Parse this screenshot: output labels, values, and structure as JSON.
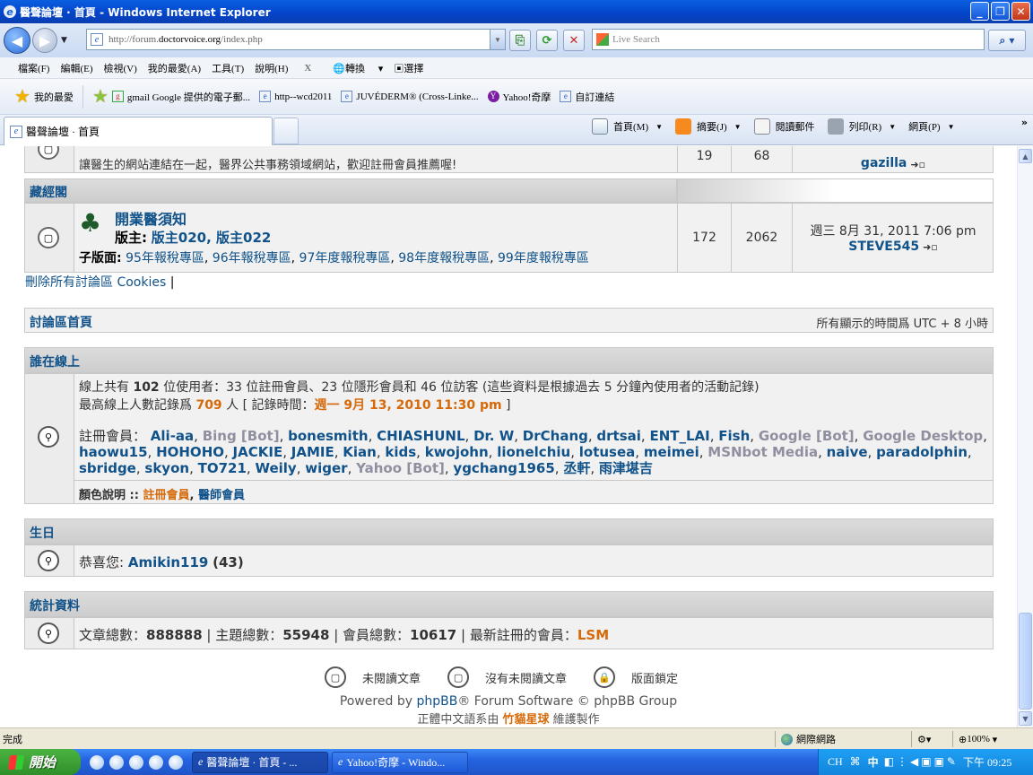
{
  "window": {
    "title": "醫聲論壇 · 首頁 - Windows Internet Explorer",
    "minimize": "_",
    "restore": "❐",
    "close": "✕"
  },
  "address": {
    "url_prefix": "http://forum.",
    "url_domain": "doctorvoice.org",
    "url_suffix": "/index.php",
    "search_placeholder": "Live Search"
  },
  "menu": [
    "檔案(F)",
    "編輯(E)",
    "檢視(V)",
    "我的最愛(A)",
    "工具(T)",
    "說明(H)"
  ],
  "menu_extra": {
    "close_x": "X",
    "translate": "轉換",
    "select": "選擇"
  },
  "favorites": {
    "label": "我的最愛",
    "items": [
      "gmail Google 提供的電子郵...",
      "http--wcd2011",
      "JUVÉDERM® (Cross-Linke...",
      "Yahoo!奇摩",
      "自訂連結"
    ]
  },
  "tabs": {
    "active_label": "醫聲論壇 · 首頁"
  },
  "commands": {
    "home": "首頁(M)",
    "feeds": "摘要(J)",
    "mail": "閱讀郵件",
    "print": "列印(R)",
    "page": "網頁(P)",
    "more": "»"
  },
  "forum": {
    "partial_row": {
      "desc": "讓醫生的網站連結在一起，醫界公共事務領域網站，歡迎註冊會員推薦喔!",
      "topics": "19",
      "posts": "68",
      "last_user": "gazilla"
    },
    "category2": "藏經閣",
    "forum2": {
      "title": "開業醫須知",
      "mods_label": "版主:",
      "mods": "版主020, 版主022",
      "sub_label": "子版面:",
      "subforums": [
        "95年報稅專區",
        "96年報稅專區",
        "97年度報稅專區",
        "98年度報稅專區",
        "99年度報稅專區"
      ],
      "topics": "172",
      "posts": "2062",
      "last_time": "週三 8月 31, 2011 7:06 pm",
      "last_user": "STEVE545"
    },
    "links": {
      "delete_all": "刪除所有討論區 Cookies",
      "sep": "|"
    },
    "nav": {
      "index": "討論區首頁",
      "timezone": "所有顯示的時間爲 UTC + 8 小時"
    },
    "online": {
      "heading": "誰在線上",
      "line1_a": "線上共有",
      "line1_count": "102",
      "line1_b": "位使用者：33 位註冊會員、23 位隱形會員和 46 位訪客 (這些資料是根據過去 5 分鐘內使用者的活動記錄)",
      "line2_a": "最高線上人數記錄爲",
      "line2_count": "709",
      "line2_b": "人 [ 記錄時間：",
      "line2_time": "週一 9月 13, 2010 11:30 pm",
      "line2_c": "]",
      "members_label": "註冊會員：",
      "members": [
        {
          "n": "Ali-aa",
          "t": "u"
        },
        {
          "n": "Bing [Bot]",
          "t": "b"
        },
        {
          "n": "bonesmith",
          "t": "u"
        },
        {
          "n": "CHIASHUNL",
          "t": "u"
        },
        {
          "n": "Dr. W",
          "t": "u"
        },
        {
          "n": "DrChang",
          "t": "u"
        },
        {
          "n": "drtsai",
          "t": "u"
        },
        {
          "n": "ENT_LAI",
          "t": "u"
        },
        {
          "n": "Fish",
          "t": "u"
        },
        {
          "n": "Google [Bot]",
          "t": "b"
        },
        {
          "n": "Google Desktop",
          "t": "b"
        },
        {
          "n": "haowu15",
          "t": "u"
        },
        {
          "n": "HOHOHO",
          "t": "u"
        },
        {
          "n": "JACKIE",
          "t": "u"
        },
        {
          "n": "JAMIE",
          "t": "u"
        },
        {
          "n": "Kian",
          "t": "u"
        },
        {
          "n": "kids",
          "t": "u"
        },
        {
          "n": "kwojohn",
          "t": "u"
        },
        {
          "n": "lionelchiu",
          "t": "u"
        },
        {
          "n": "lotusea",
          "t": "u"
        },
        {
          "n": "meimei",
          "t": "u"
        },
        {
          "n": "MSNbot Media",
          "t": "b"
        },
        {
          "n": "naive",
          "t": "u"
        },
        {
          "n": "paradolphin",
          "t": "u"
        },
        {
          "n": "sbridge",
          "t": "u"
        },
        {
          "n": "skyon",
          "t": "u"
        },
        {
          "n": "TO721",
          "t": "u"
        },
        {
          "n": "Weily",
          "t": "u"
        },
        {
          "n": "wiger",
          "t": "u"
        },
        {
          "n": "Yahoo [Bot]",
          "t": "b"
        },
        {
          "n": "ygchang1965",
          "t": "u"
        },
        {
          "n": "丞軒",
          "t": "u"
        },
        {
          "n": "雨津堪吉",
          "t": "u"
        }
      ],
      "legend_label": "顏色說明 ::",
      "legend_reg": "註冊會員",
      "legend_doc": "醫師會員"
    },
    "birthday": {
      "heading": "生日",
      "label": "恭喜您:",
      "user": "Amikin119",
      "age": "(43)"
    },
    "stats": {
      "heading": "統計資料",
      "posts_label": "文章總數：",
      "posts": "888888",
      "topics_label": "主題總數：",
      "topics": "55948",
      "members_label": "會員總數：",
      "members": "10617",
      "newest_label": "最新註冊的會員：",
      "newest": "LSM"
    },
    "legend": {
      "unread": "未閱讀文章",
      "none": "沒有未閱讀文章",
      "locked": "版面鎖定"
    },
    "footer": {
      "powered_a": "Powered by",
      "phpbb": "phpBB",
      "powered_b": "® Forum Software © phpBB Group",
      "cn_a": "正體中文語系由",
      "cn_b": "竹貓星球",
      "cn_c": "維護製作"
    }
  },
  "status": {
    "left": "完成",
    "zone": "網際網路",
    "zoom": "100%"
  },
  "taskbar": {
    "start": "開始",
    "win1": "醫聲論壇 · 首頁 - ...",
    "win2": "Yahoo!奇摩 - Windo...",
    "ime": "CH",
    "ime2": "中",
    "clock": "下午 09:25"
  },
  "colors": {
    "link": "#105289",
    "orange": "#d66a0b",
    "bot": "#8f8f9f"
  }
}
